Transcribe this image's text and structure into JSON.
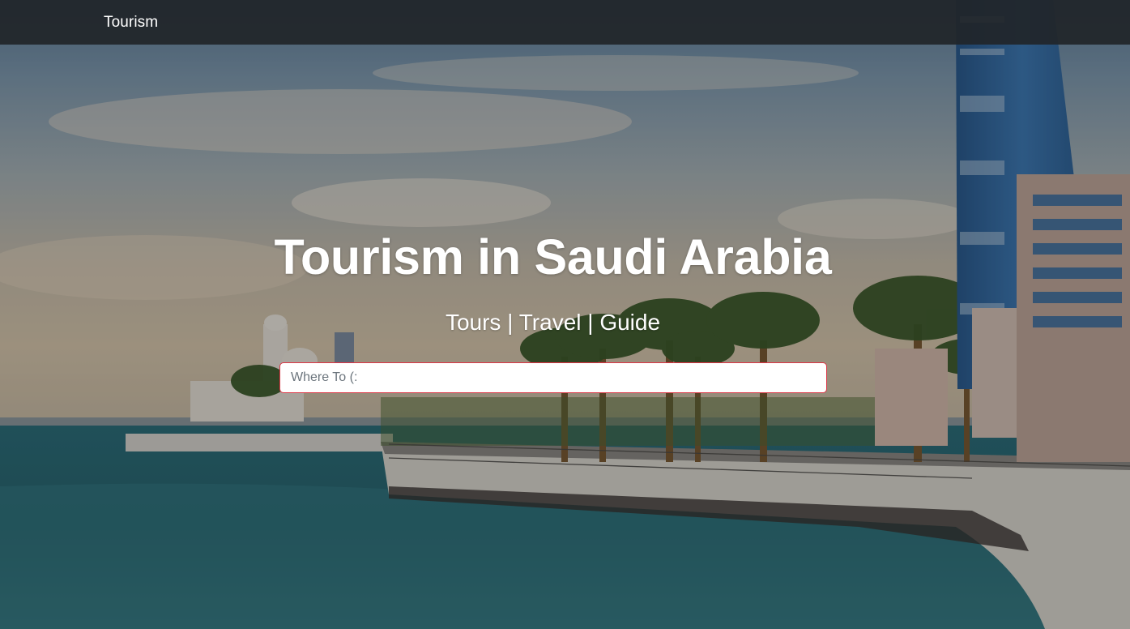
{
  "navbar": {
    "brand": "Tourism",
    "background_color": "#212529"
  },
  "hero": {
    "title": "Tourism in Saudi Arabia",
    "subtitle": "Tours | Travel | Guide",
    "search": {
      "placeholder": "Where To (:",
      "value": "",
      "border_color": "#dc3545"
    },
    "background_image": "waterfront-promenade-with-palms-and-towers"
  }
}
